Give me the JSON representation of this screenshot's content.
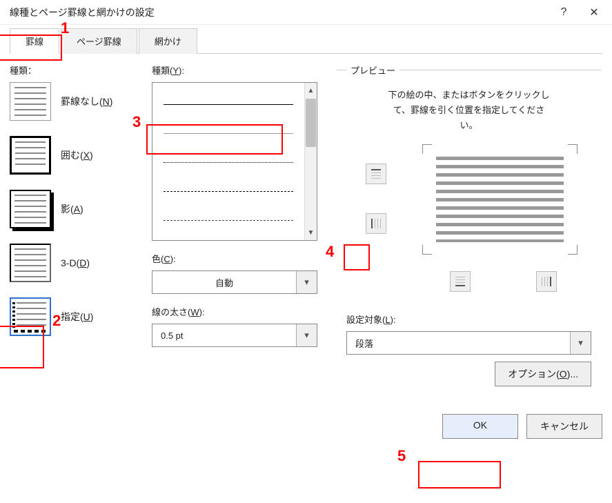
{
  "title": "線種とページ罫線と網かけの設定",
  "tabs": {
    "borders": "罫線",
    "page_borders": "ページ罫線",
    "shading": "網かけ"
  },
  "col1_label": "種類：",
  "settings": {
    "none": "罫線なし(N)",
    "box": "囲む(X)",
    "shadow": "影(A)",
    "three_d": "3-D(D)",
    "custom": "指定(U)"
  },
  "style_label": "種類(Y):",
  "color_label": "色(C):",
  "color_value": "自動",
  "width_label": "線の太さ(W):",
  "width_value": "0.5 pt",
  "preview": {
    "legend": "プレビュー",
    "hint_l1": "下の絵の中、またはボタンをクリックし",
    "hint_l2": "て、罫線を引く位置を指定してくださ",
    "hint_l3": "い。"
  },
  "apply_label": "設定対象(L):",
  "apply_value": "段落",
  "options_btn": "オプション(O)...",
  "ok": "OK",
  "cancel": "キャンセル",
  "notes": {
    "n1": "1",
    "n2": "2",
    "n3": "3",
    "n4": "4",
    "n5": "5"
  }
}
